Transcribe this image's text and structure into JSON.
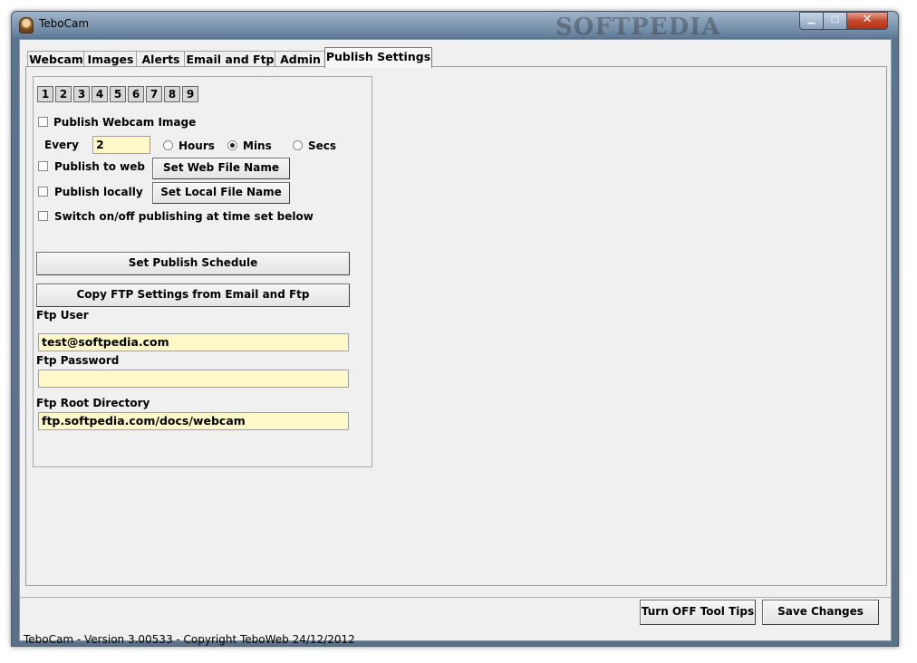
{
  "window": {
    "title": "TeboCam",
    "watermark": "SOFTPEDIA",
    "min_glyph": "▁",
    "max_glyph": "□",
    "close_glyph": "✕"
  },
  "tabs": [
    {
      "label": "Webcam"
    },
    {
      "label": "Images"
    },
    {
      "label": "Alerts"
    },
    {
      "label": "Email and Ftp"
    },
    {
      "label": "Admin"
    },
    {
      "label": "Publish Settings"
    }
  ],
  "numbers": [
    "1",
    "2",
    "3",
    "4",
    "5",
    "6",
    "7",
    "8",
    "9"
  ],
  "publish": {
    "webcam_image_label": "Publish Webcam Image",
    "every_label": "Every",
    "every_value": "2",
    "hours_label": "Hours",
    "mins_label": "Mins",
    "secs_label": "Secs",
    "selected_unit": "Mins",
    "to_web_label": "Publish to web",
    "set_web_file_btn": "Set Web File Name",
    "locally_label": "Publish locally",
    "set_local_file_btn": "Set Local File Name",
    "switch_label": "Switch on/off publishing at time set below",
    "schedule_btn": "Set Publish Schedule",
    "copy_ftp_btn": "Copy FTP Settings from Email and Ftp"
  },
  "ftp": {
    "user_label": "Ftp User",
    "user_value": "test@softpedia.com",
    "password_label": "Ftp Password",
    "password_value": "",
    "root_label": "Ftp Root Directory",
    "root_value": "ftp.softpedia.com/docs/webcam"
  },
  "footer": {
    "tooltips_btn": "Turn OFF Tool Tips",
    "save_btn": "Save Changes",
    "status": "TeboCam - Version 3.00533 - Copyright TeboWeb 24/12/2012"
  },
  "colors": {
    "field_bg": "#fff8c8",
    "panel_bg": "#f0f0f0"
  }
}
